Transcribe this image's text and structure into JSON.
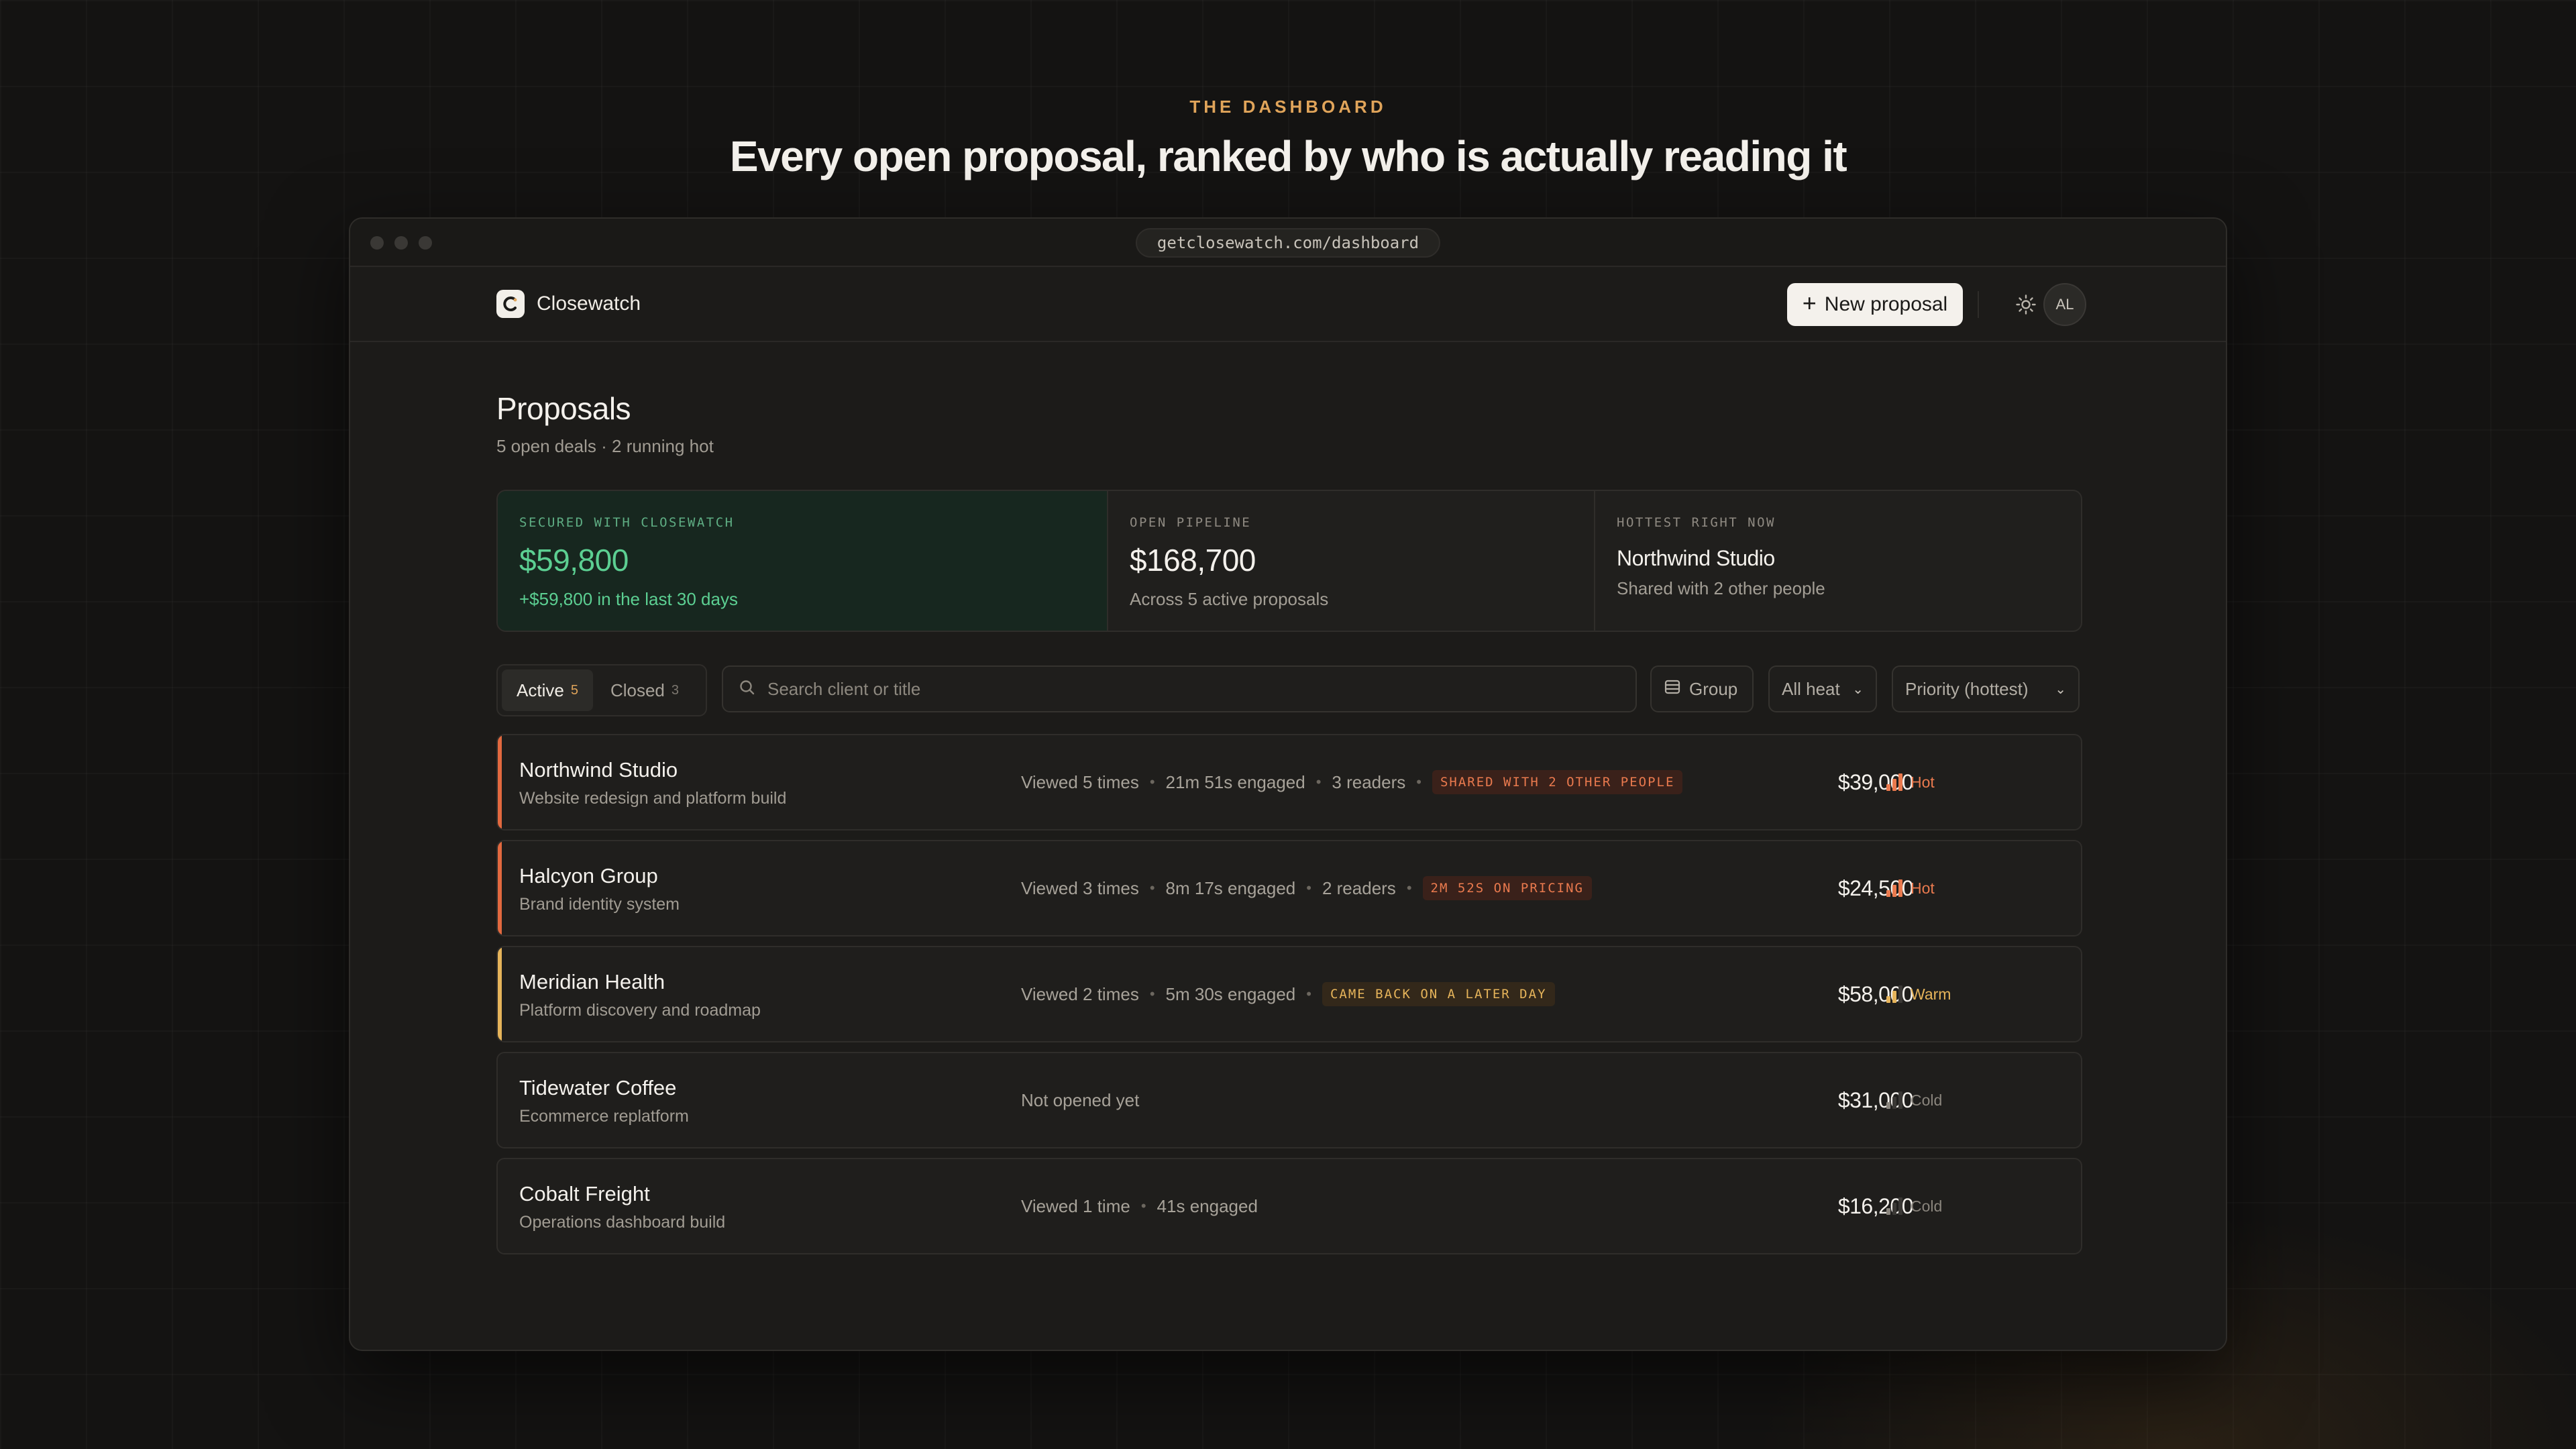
{
  "hero": {
    "eyebrow": "THE DASHBOARD",
    "headline": "Every open proposal, ranked by who is actually reading it"
  },
  "browser": {
    "url": "getclosewatch.com/dashboard"
  },
  "nav": {
    "brand": "Closewatch",
    "new_button": "New proposal",
    "avatar_initials": "AL",
    "theme_icon": "sun-icon"
  },
  "page": {
    "title": "Proposals",
    "subtitle": "5 open deals · 2 running hot"
  },
  "stats": [
    {
      "label": "SECURED WITH CLOSEWATCH",
      "value": "$59,800",
      "note": "+$59,800 in the last 30 days"
    },
    {
      "label": "OPEN PIPELINE",
      "value": "$168,700",
      "note": "Across 5 active proposals"
    },
    {
      "label": "HOTTEST RIGHT NOW",
      "value": "Northwind Studio",
      "note": "Shared with 2 other people"
    }
  ],
  "toolbar": {
    "tabs": [
      {
        "label": "Active",
        "count": "5"
      },
      {
        "label": "Closed",
        "count": "3"
      }
    ],
    "search_placeholder": "Search client or title",
    "group_label": "Group",
    "heat_filter": "All heat",
    "sort": "Priority (hottest)"
  },
  "proposals": [
    {
      "client": "Northwind Studio",
      "title": "Website redesign and platform build",
      "meta": [
        "Viewed 5 times",
        "21m 51s engaged",
        "3 readers"
      ],
      "tag": "SHARED WITH 2 OTHER PEOPLE",
      "amount": "$39,000",
      "heat": "Hot",
      "heat_level": 3,
      "accent": "#e2693f"
    },
    {
      "client": "Halcyon Group",
      "title": "Brand identity system",
      "meta": [
        "Viewed 3 times",
        "8m 17s engaged",
        "2 readers"
      ],
      "tag": "2M 52S ON PRICING",
      "amount": "$24,500",
      "heat": "Hot",
      "heat_level": 3,
      "accent": "#e2693f"
    },
    {
      "client": "Meridian Health",
      "title": "Platform discovery and roadmap",
      "meta": [
        "Viewed 2 times",
        "5m 30s engaged"
      ],
      "tag": "CAME BACK ON A LATER DAY",
      "amount": "$58,000",
      "heat": "Warm",
      "heat_level": 2,
      "accent": "#e6b45a"
    },
    {
      "client": "Tidewater Coffee",
      "title": "Ecommerce replatform",
      "meta": [
        "Not opened yet"
      ],
      "tag": "",
      "amount": "$31,000",
      "heat": "Cold",
      "heat_level": 1,
      "accent": ""
    },
    {
      "client": "Cobalt Freight",
      "title": "Operations dashboard build",
      "meta": [
        "Viewed 1 time",
        "41s engaged"
      ],
      "tag": "",
      "amount": "$16,200",
      "heat": "Cold",
      "heat_level": 1,
      "accent": ""
    }
  ]
}
